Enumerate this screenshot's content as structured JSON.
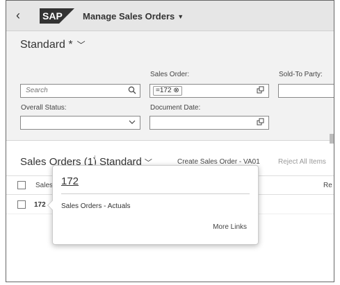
{
  "shell": {
    "back_icon": "back-chevron-icon",
    "logo_text": "SAP",
    "app_title": "Manage Sales Orders",
    "app_title_caret": "▼"
  },
  "variant": {
    "title": "Standard *",
    "chevron": "﹀"
  },
  "filters": {
    "search": {
      "placeholder": "Search",
      "icon": "search-icon"
    },
    "sales_order": {
      "label": "Sales Order:",
      "token": "=172",
      "token_remove": "⊗",
      "icon": "value-help-icon"
    },
    "sold_to_party": {
      "label": "Sold-To Party:"
    },
    "overall_status": {
      "label": "Overall Status:",
      "icon": "dropdown-icon"
    },
    "document_date": {
      "label": "Document Date:",
      "icon": "value-help-icon"
    }
  },
  "table": {
    "title": "Sales Orders (1)",
    "variant": "Standard",
    "variant_chevron": "﹀",
    "actions": {
      "create": "Create Sales Order - VA01",
      "reject": "Reject All Items"
    },
    "headers": {
      "sales": "Sales",
      "re": "Re"
    },
    "rows": [
      {
        "sales_order": "172"
      }
    ]
  },
  "popover": {
    "title": "172",
    "link": "Sales Orders - Actuals",
    "more_links": "More Links"
  },
  "colors": {
    "shell_bg": "#e6e6e6",
    "filter_bg": "#f2f2f2",
    "sap_logo_bg": "#333333"
  }
}
